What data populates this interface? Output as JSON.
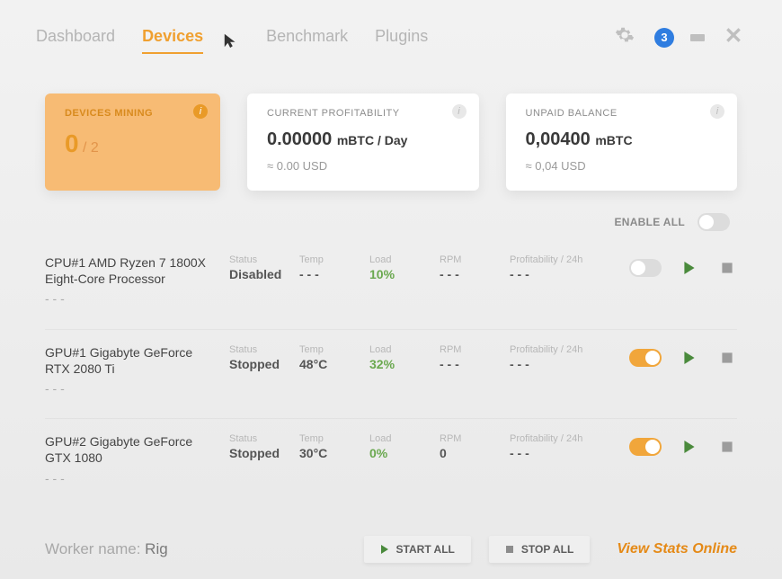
{
  "nav": {
    "items": [
      "Dashboard",
      "Devices",
      "Benchmark",
      "Plugins"
    ],
    "active_index": 1
  },
  "header": {
    "notification_count": "3"
  },
  "cards": {
    "mining": {
      "title": "DEVICES MINING",
      "count": "0",
      "sep": " / ",
      "total": "2"
    },
    "profit": {
      "title": "CURRENT PROFITABILITY",
      "value": "0.00000",
      "unit": "mBTC / Day",
      "approx": "≈ 0.00 USD"
    },
    "balance": {
      "title": "UNPAID BALANCE",
      "value": "0,00400",
      "unit": "mBTC",
      "approx": "≈ 0,04 USD"
    }
  },
  "enable_all_label": "ENABLE ALL",
  "columns": {
    "status": "Status",
    "temp": "Temp",
    "load": "Load",
    "rpm": "RPM",
    "profit": "Profitability / 24h"
  },
  "devices": [
    {
      "name": "CPU#1 AMD Ryzen 7 1800X Eight-Core Processor",
      "status": "Disabled",
      "temp": "- - -",
      "load": "10%",
      "rpm": "- - -",
      "profit": "- - -",
      "enabled": false
    },
    {
      "name": "GPU#1 Gigabyte GeForce RTX 2080 Ti",
      "status": "Stopped",
      "temp": "48°C",
      "load": "32%",
      "rpm": "- - -",
      "profit": "- - -",
      "enabled": true
    },
    {
      "name": "GPU#2 Gigabyte GeForce GTX 1080",
      "status": "Stopped",
      "temp": "30°C",
      "load": "0%",
      "rpm": "0",
      "profit": "- - -",
      "enabled": true
    }
  ],
  "footer": {
    "worker_label": "Worker name: ",
    "worker_name": "Rig",
    "start_all": "START ALL",
    "stop_all": "STOP ALL",
    "view_link": "View Stats Online"
  }
}
